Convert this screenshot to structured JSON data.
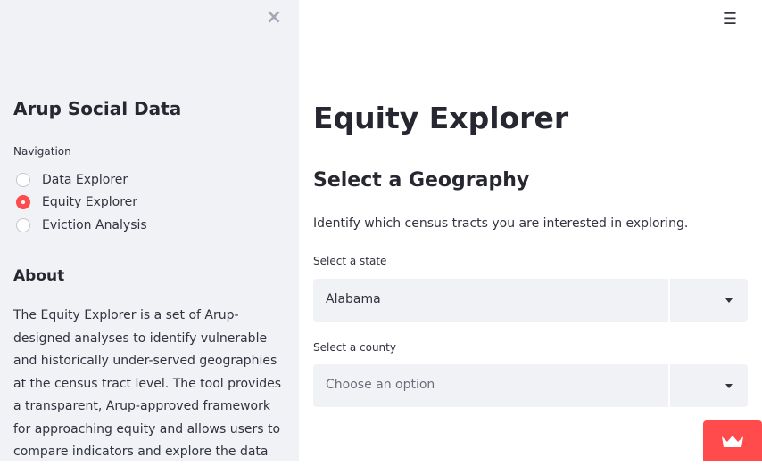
{
  "sidebar": {
    "close_icon": "close-icon",
    "title": "Arup Social Data",
    "navigation_label": "Navigation",
    "nav_items": [
      {
        "label": "Data Explorer",
        "selected": false
      },
      {
        "label": "Equity Explorer",
        "selected": true
      },
      {
        "label": "Eviction Analysis",
        "selected": false
      }
    ],
    "about_title": "About",
    "about_text": "The Equity Explorer is a set of Arup-designed analyses to identify vulnerable and historically under-served geographies at the census tract level. The tool provides a transparent, Arup-approved framework for approaching equity and allows users to compare indicators and explore the data for"
  },
  "header": {
    "menu_icon": "hamburger-menu-icon"
  },
  "main": {
    "title": "Equity Explorer",
    "section_title": "Select a Geography",
    "description": "Identify which census tracts you are interested in exploring.",
    "state_select": {
      "label": "Select a state",
      "value": "Alabama"
    },
    "county_select": {
      "label": "Select a county",
      "placeholder": "Choose an option"
    }
  },
  "badge": {
    "icon": "crown-icon"
  },
  "colors": {
    "accent": "#ff4b4b",
    "sidebar_bg": "#f0f2f6",
    "text": "#262730"
  }
}
